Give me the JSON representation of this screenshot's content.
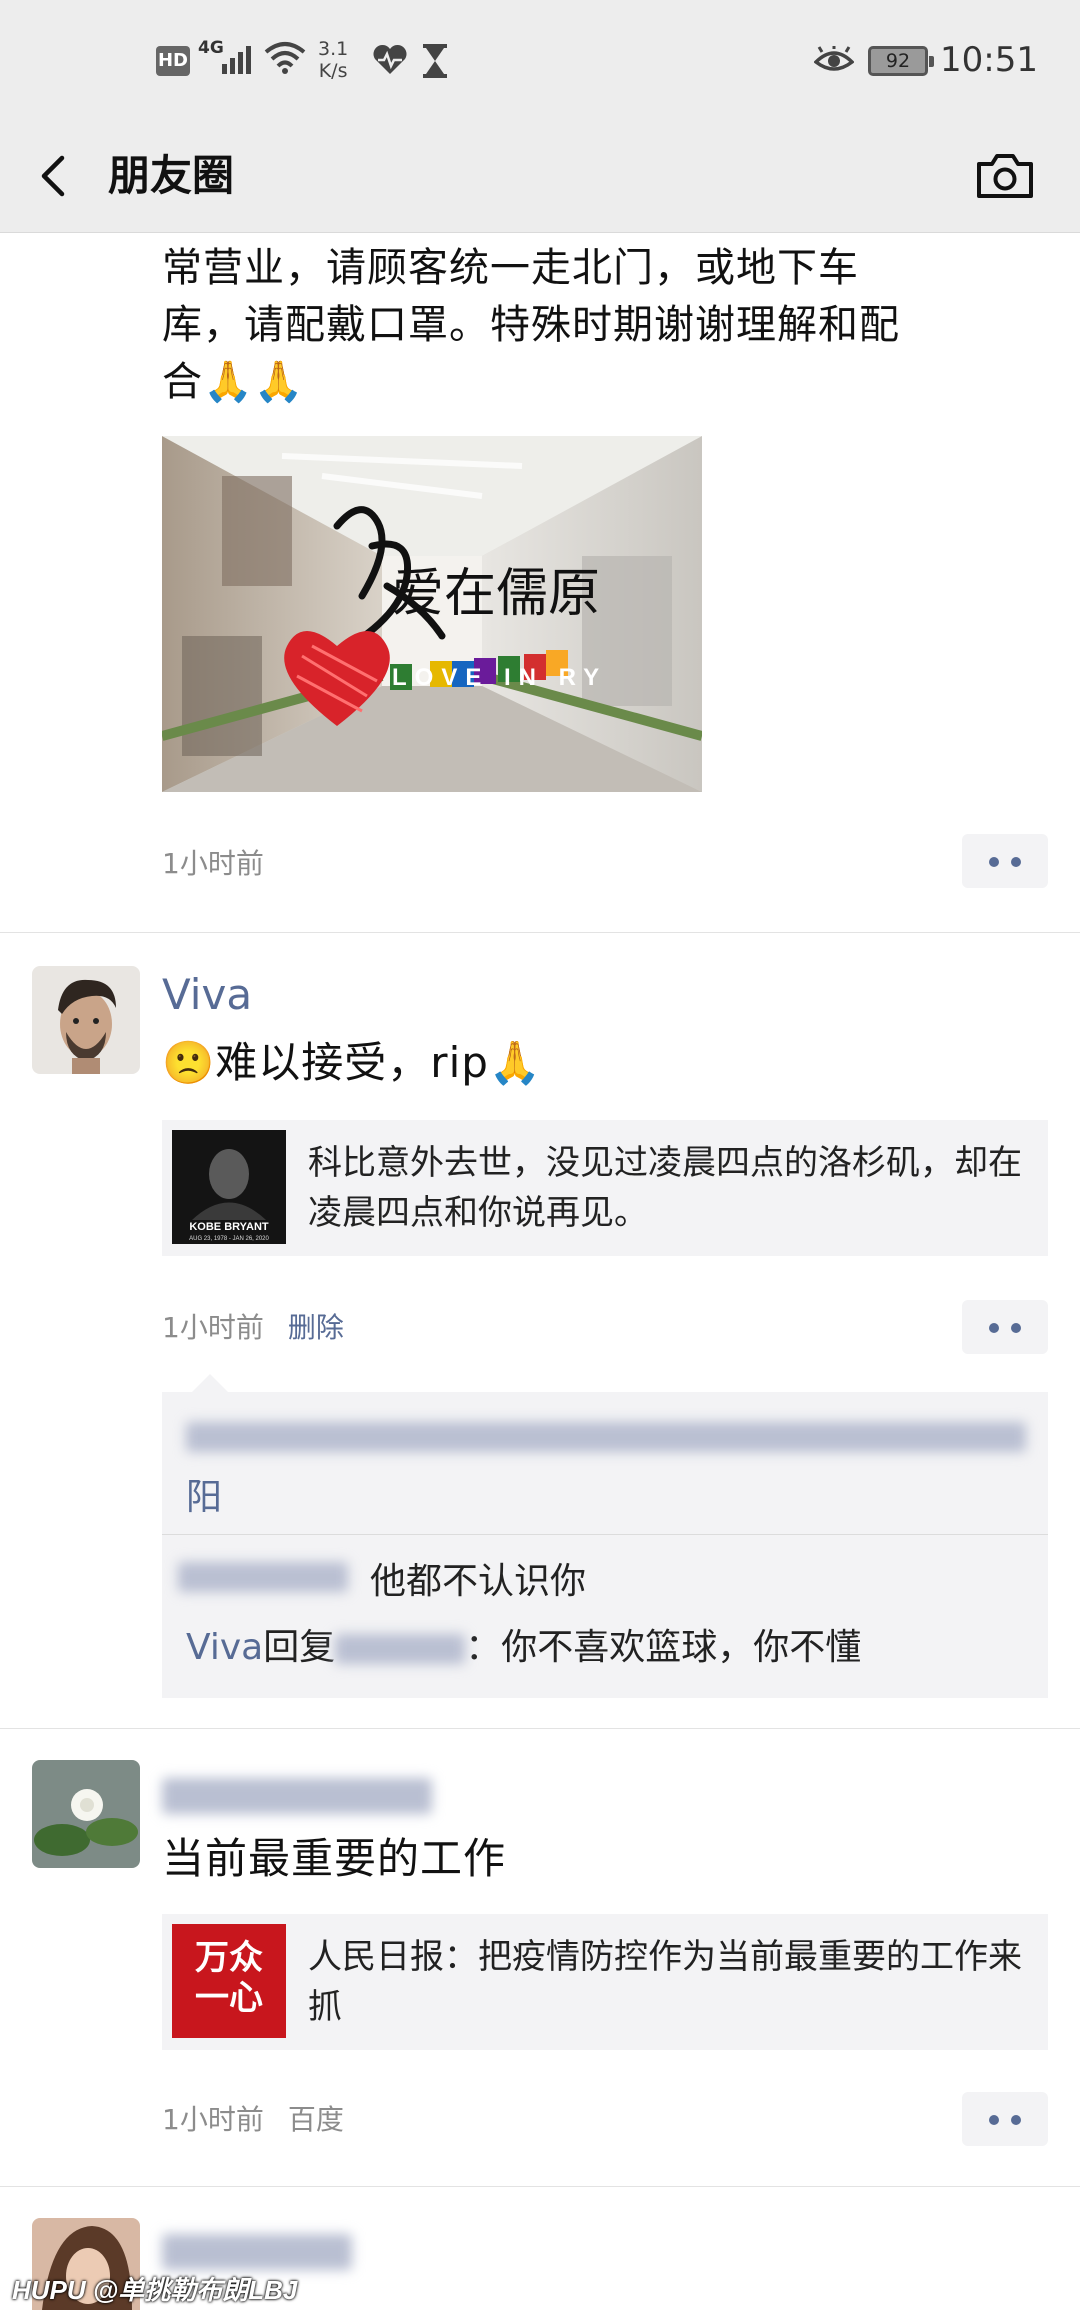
{
  "status_bar": {
    "hd": "HD",
    "network": "4G",
    "speed_value": "3.1",
    "speed_unit": "K/s",
    "battery": "92",
    "time": "10:51"
  },
  "nav": {
    "title": "朋友圈",
    "back_icon": "chevron-left-icon",
    "camera_icon": "camera-icon"
  },
  "post1": {
    "text_lines": [
      "常营业，请顾客统一走北门，或地下车",
      "库，请配戴口罩。特殊时期谢谢理解和配",
      "合🙏🙏"
    ],
    "image_calligraphy": "爱在儒原",
    "image_tag": "LOVE IN RY",
    "time": "1小时前"
  },
  "post2": {
    "nickname": "Viva",
    "text": "🙁难以接受，rip🙏",
    "link_thumb_caption": "KOBE BRYANT",
    "link_thumb_dates": "AUG 23, 1978 - JAN 26, 2020",
    "link_text": "科比意外去世，没见过凌晨四点的洛杉矶，却在凌晨四点和你说再见。",
    "time": "1小时前",
    "delete_label": "删除",
    "likes_tail": "阳",
    "comment1_text": "他都不认识你",
    "comment2_author": "Viva",
    "comment2_reply_word": "回复",
    "comment2_text": "：你不喜欢篮球，你不懂"
  },
  "post3": {
    "text": "当前最重要的工作",
    "link_thumb_text": "万众一心",
    "link_text": "人民日报：把疫情防控作为当前最重要的工作来抓",
    "time": "1小时前",
    "source": "百度"
  },
  "watermark": "HUPU @单挑勒布朗LBJ",
  "colors": {
    "link_blue": "#576b95",
    "chrome_gray": "#ededed",
    "card_gray": "#f3f3f5"
  }
}
